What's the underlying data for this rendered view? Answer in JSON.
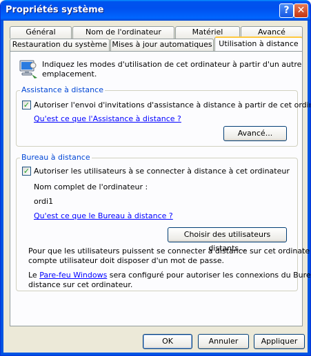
{
  "window": {
    "title": "Propriétés système"
  },
  "titlebar": {
    "help_glyph": "?",
    "close_glyph": "✕"
  },
  "tabs_back": [
    "Général",
    "Nom de l'ordinateur",
    "Matériel",
    "Avancé"
  ],
  "tabs_front": [
    "Restauration du système",
    "Mises à jour automatiques",
    "Utilisation à distance"
  ],
  "active_tab": "Utilisation à distance",
  "intro": {
    "line1": "Indiquez les modes d'utilisation de cet ordinateur à partir d'un autre",
    "line2": "emplacement."
  },
  "assistance": {
    "legend": "Assistance à distance",
    "checkbox_label": "Autoriser l'envoi d'invitations d'assistance à distance à partir de cet ordinateur",
    "checked": true,
    "help_link": "Qu'est ce que l'Assistance à distance ?",
    "advanced_button": "Avancé..."
  },
  "remote_desktop": {
    "legend": "Bureau à distance",
    "checkbox_label": "Autoriser les utilisateurs à se connecter à distance à cet ordinateur",
    "checked": true,
    "computer_name_label": "Nom complet de l'ordinateur :",
    "computer_name": "ordi1",
    "help_link": "Qu'est ce que le Bureau à distance ?",
    "select_users_button": "Choisir des utilisateurs distants...",
    "note_line1": "Pour que les utilisateurs puissent se connecter à distance sur cet ordinateur, le",
    "note_line2": "compte utilisateur doit disposer d'un mot de passe.",
    "firewall_prefix": "Le ",
    "firewall_link": "Pare-feu Windows",
    "firewall_suffix": " sera configuré pour autoriser les connexions du Bureau à",
    "firewall_line2": "distance sur cet ordinateur."
  },
  "footer": {
    "ok": "OK",
    "cancel": "Annuler",
    "apply": "Appliquer"
  },
  "colors": {
    "title_blue": "#0054e3",
    "group_label": "#0046d5",
    "active_tab_accent": "#ffc83c"
  }
}
